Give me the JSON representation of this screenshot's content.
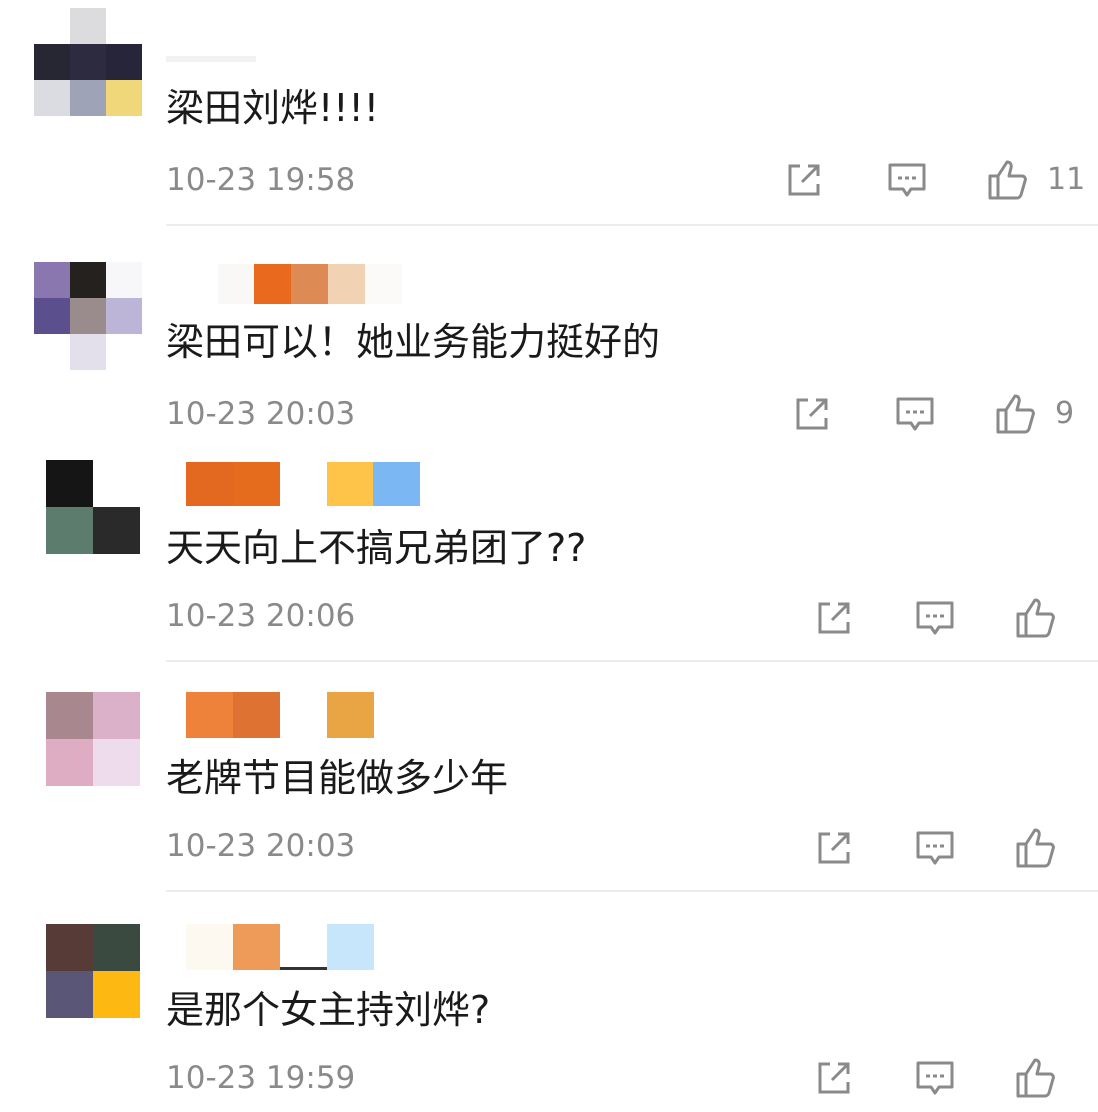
{
  "comments": [
    {
      "text": "梁田刘烨!!!!",
      "time": "10-23 19:58",
      "likes": "11",
      "avatar_colors": [
        "#ffffff",
        "#dcdcdf",
        "#ffffff",
        "#272734",
        "#2c2b3f",
        "#26253a",
        "#dbdbe2",
        "#9fa3b8",
        "#f0d77a"
      ],
      "name_colors": [
        "#eeeeee"
      ]
    },
    {
      "text": "梁田可以！她业务能力挺好的",
      "time": "10-23 20:03",
      "likes": "9",
      "avatar_colors": [
        "#ffffff",
        "#e5e2ee",
        "#ffffff",
        "#8a77b0",
        "#25211f",
        "#f7f7f9",
        "#5c4f8e",
        "#9a8c8d",
        "#bcb5d8",
        "#ffffff",
        "#e3e0ec",
        "#ffffff"
      ],
      "name_colors": [
        "#faf8f6",
        "#e96a1f",
        "#de8a55",
        "#f1d2b2",
        "#fbfaf9"
      ]
    },
    {
      "text": "天天向上不搞兄弟团了??",
      "time": "10-23 20:06",
      "likes": "",
      "avatar_colors": [
        "#151515",
        "#ffffff",
        "#5c7c6e",
        "#2a2a2a"
      ],
      "name_colors": [
        "#e2691f",
        "#e56c1d",
        "#ffffff",
        "#fdc449",
        "#7bb7f2"
      ]
    },
    {
      "text": "老牌节目能做多少年",
      "time": "10-23 20:03",
      "likes": "",
      "avatar_colors": [
        "#a8878f",
        "#dbb0c9",
        "#deacc3",
        "#eedcec"
      ],
      "name_colors": [
        "#ee823b",
        "#de7232",
        "#ffffff",
        "#e9a443"
      ]
    },
    {
      "text": "是那个女主持刘烨?",
      "time": "10-23 19:59",
      "likes": "",
      "avatar_colors": [
        "#573b37",
        "#3b4a41",
        "#5a5678",
        "#fdb912"
      ],
      "name_colors": [
        "#fdf9f1",
        "#ee9a58",
        "#ffffff",
        "#c7e6fb"
      ]
    }
  ]
}
